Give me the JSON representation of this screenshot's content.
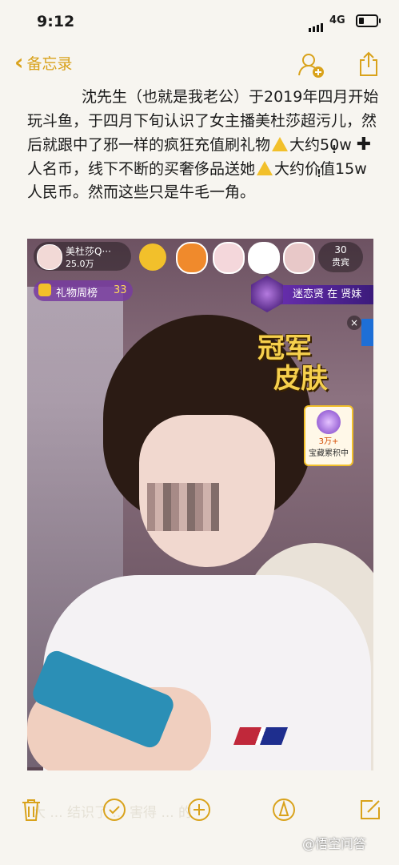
{
  "status_bar": {
    "time": "9:12",
    "network": "4G"
  },
  "nav": {
    "back_label": "备忘录"
  },
  "note": {
    "p1": "沈先生（也就是我老公）于2019年四月开始玩斗鱼，于四月下旬认识了女主播美杜莎超污儿，然后就跟中了邪一样的疯狂充值刷礼物",
    "p2": "大约50w",
    "p3": "人名币，线下不断的买奢侈品送她",
    "p4": "大约价值15w人民币。然而这些只是牛毛一角。"
  },
  "stream": {
    "anchor_name": "美杜莎Q···",
    "fans": "25.0万",
    "gift_rank_label": "礼物周榜",
    "gift_rank_count": "33",
    "guests_count": "30",
    "guests_label": "贵宾",
    "fan_group": "迷恋贤 在 贤妹",
    "promo_line1": "冠军",
    "promo_line2": "皮肤",
    "treasure_value": "3万+",
    "treasure_label": "宝藏累积中",
    "close_glyph": "×"
  },
  "toolbar": {
    "ghost_text": "大 ... 结识了 ... 害得 ... 的"
  },
  "watermark": "@悟空问答",
  "icons": [
    "back-chevron-icon",
    "add-person-icon",
    "share-icon",
    "trash-icon",
    "checklist-icon",
    "add-icon",
    "compose-pen-icon",
    "new-note-icon"
  ],
  "colors": {
    "accent": "#d9a21b",
    "background": "#f7f5f0"
  }
}
